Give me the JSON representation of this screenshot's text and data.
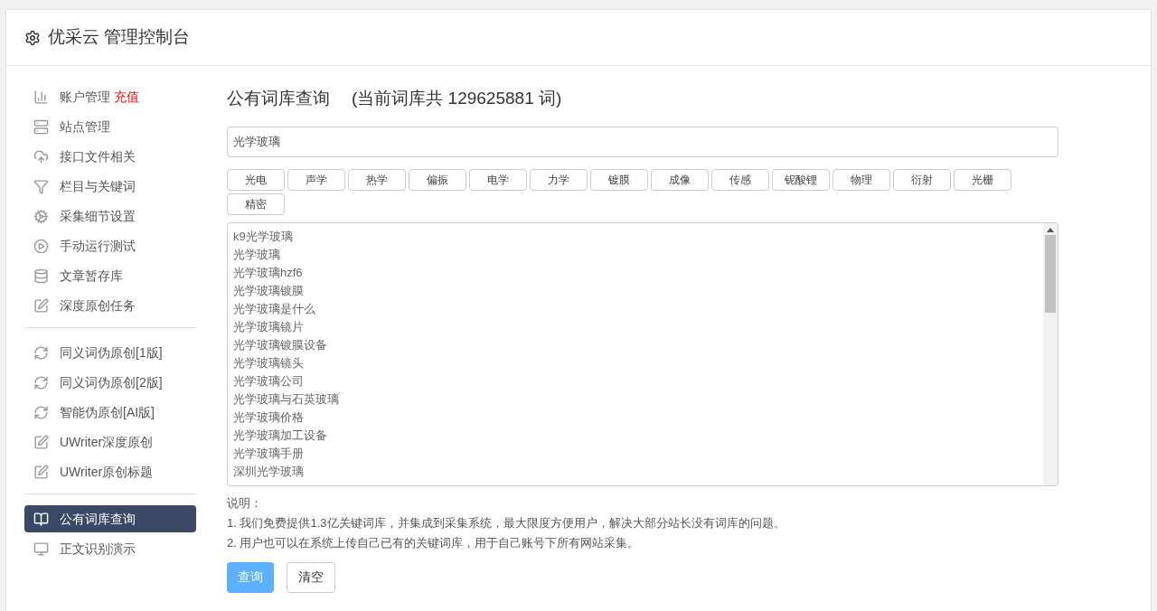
{
  "header": {
    "title": "优采云 管理控制台"
  },
  "sidebar": {
    "groups": [
      {
        "items": [
          {
            "label": "账户管理",
            "badge": "充值",
            "selected": false
          },
          {
            "label": "站点管理",
            "selected": false
          },
          {
            "label": "接口文件相关",
            "selected": false
          },
          {
            "label": "栏目与关键词",
            "selected": false
          },
          {
            "label": "采集细节设置",
            "selected": false
          },
          {
            "label": "手动运行测试",
            "selected": false
          },
          {
            "label": "文章暂存库",
            "selected": false
          },
          {
            "label": "深度原创任务",
            "selected": false
          }
        ]
      },
      {
        "items": [
          {
            "label": "同义词伪原创[1版]",
            "selected": false
          },
          {
            "label": "同义词伪原创[2版]",
            "selected": false
          },
          {
            "label": "智能伪原创[AI版]",
            "selected": false
          },
          {
            "label": "UWriter深度原创",
            "selected": false
          },
          {
            "label": "UWriter原创标题",
            "selected": false
          }
        ]
      },
      {
        "items": [
          {
            "label": "公有词库查询",
            "selected": true
          },
          {
            "label": "正文识别演示",
            "selected": false
          }
        ]
      }
    ]
  },
  "main": {
    "title": "公有词库查询",
    "count_text": "(当前词库共 129625881 词)",
    "search": {
      "value": "光学玻璃"
    },
    "tags": [
      "光电",
      "声学",
      "热学",
      "偏振",
      "电学",
      "力学",
      "镀膜",
      "成像",
      "传感",
      "铌酸锂",
      "物理",
      "衍射",
      "光栅",
      "精密"
    ],
    "results": [
      "k9光学玻璃",
      "光学玻璃",
      "光学玻璃hzf6",
      "光学玻璃镀膜",
      "光学玻璃是什么",
      "光学玻璃镜片",
      "光学玻璃镀膜设备",
      "光学玻璃镜头",
      "光学玻璃公司",
      "光学玻璃与石英玻璃",
      "光学玻璃价格",
      "光学玻璃加工设备",
      "光学玻璃手册",
      "深圳光学玻璃"
    ],
    "notes_title": "说明：",
    "notes": [
      "1. 我们免费提供1.3亿关键词库，并集成到采集系统，最大限度方便用户，解决大部分站长没有词库的问题。",
      "2. 用户也可以在系统上传自己已有的关键词库，用于自己账号下所有网站采集。"
    ],
    "buttons": [
      {
        "label": "查询",
        "kind": "primary"
      },
      {
        "label": "清空",
        "kind": "default"
      }
    ]
  }
}
